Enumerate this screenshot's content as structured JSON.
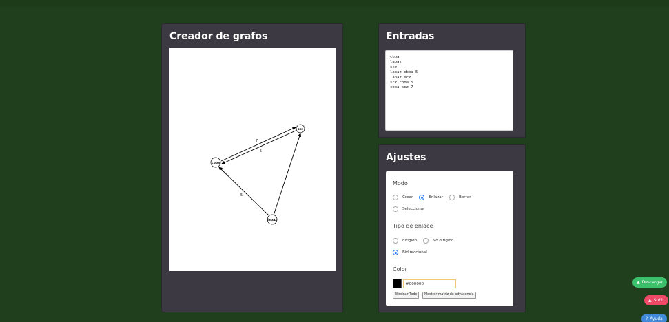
{
  "graph_panel": {
    "title": "Creador de grafos"
  },
  "graph": {
    "nodes": [
      {
        "id": "cbba",
        "label": "cbba"
      },
      {
        "id": "lapaz",
        "label": "lapaz"
      },
      {
        "id": "scz",
        "label": "scz"
      }
    ],
    "edge_labels": [
      "7",
      "5",
      "5"
    ]
  },
  "inputs_panel": {
    "title": "Entradas",
    "text": "cbba\nlapaz\nscz\nlapaz cbba 5\nlapaz scz\nscz cbba 5\ncbba scz 7"
  },
  "settings_panel": {
    "title": "Ajustes",
    "mode": {
      "label": "Modo",
      "options": [
        "Crear",
        "Enlazar",
        "Borrar",
        "Seleccionar"
      ],
      "selected": "Enlazar"
    },
    "link_type": {
      "label": "Tipo de enlace",
      "options": [
        "dirigido",
        "No dirigido",
        "Bidireccional"
      ],
      "selected": "Bidireccional"
    },
    "color": {
      "label": "Color",
      "value": "#000000",
      "swatch": "#000000"
    },
    "buttons": {
      "clear_all": "Eliminar Todo",
      "show_matrix": "Mostrar matriz de adyacencia"
    }
  },
  "fabs": {
    "download": {
      "label": "Descargar",
      "icon": "download-icon",
      "color": "#3cbf6a"
    },
    "upload": {
      "label": "Subir",
      "icon": "upload-icon",
      "color": "#ee4966"
    },
    "help": {
      "label": "Ayuda",
      "icon": "help-icon",
      "color": "#3f89d8"
    }
  }
}
